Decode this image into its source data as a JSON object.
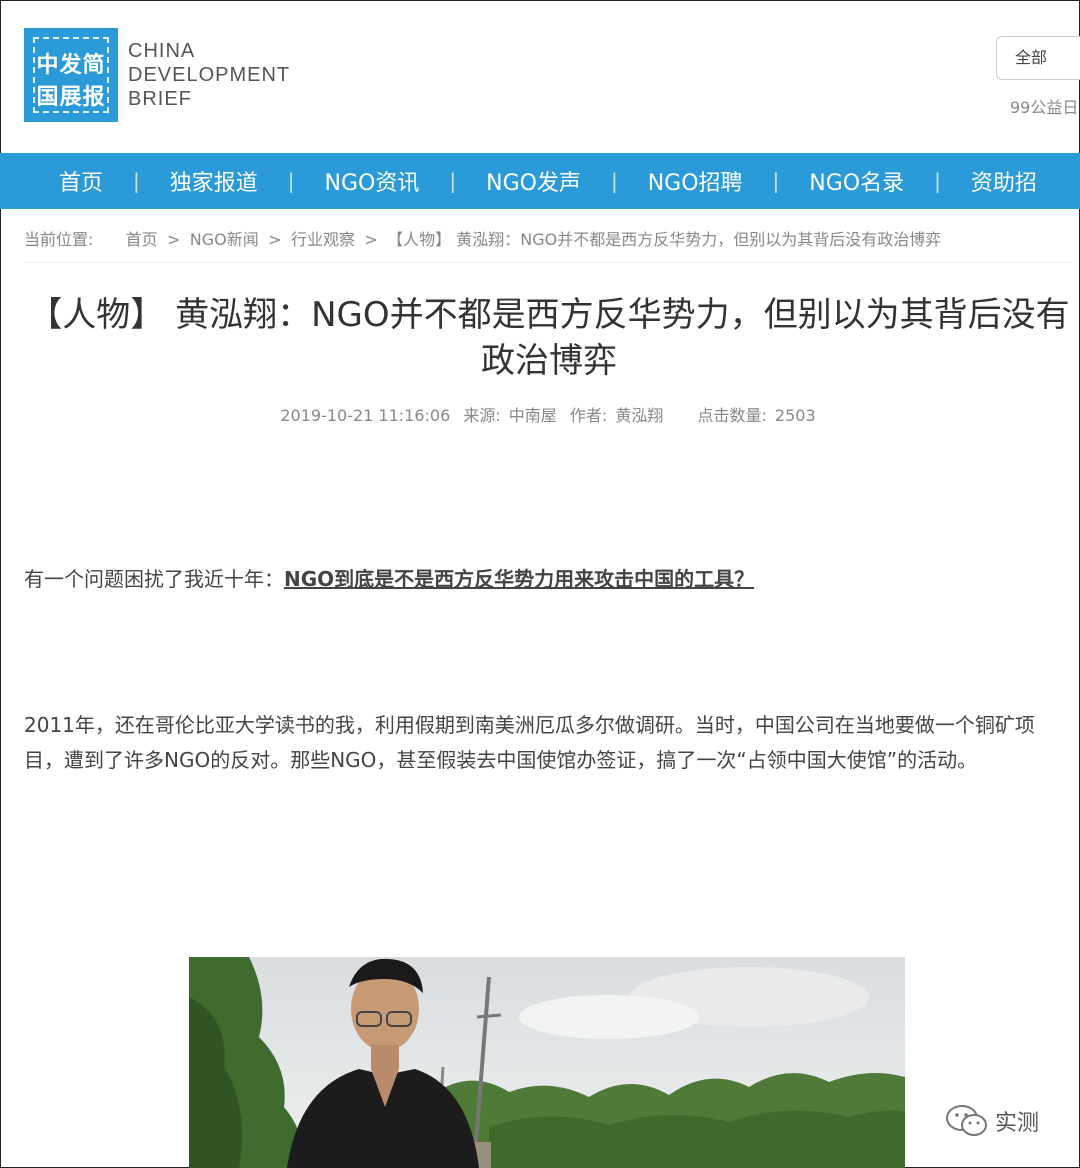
{
  "brand": {
    "logo_cn_line1": "中发简",
    "logo_cn_line2": "国展报",
    "logo_en_line1": "CHINA",
    "logo_en_line2": "DEVELOPMENT",
    "logo_en_line3": "BRIEF",
    "color": "#2a9ad8"
  },
  "header": {
    "search_scope": "全部",
    "sub_link": "99公益日"
  },
  "nav": {
    "items": [
      "首页",
      "独家报道",
      "NGO资讯",
      "NGO发声",
      "NGO招聘",
      "NGO名录",
      "资助招"
    ]
  },
  "breadcrumb": {
    "prefix": "当前位置:",
    "items": [
      "首页",
      "NGO新闻",
      "行业观察",
      "【人物】 黄泓翔：NGO并不都是西方反华势力，但别以为其背后没有政治博弈"
    ],
    "separator": ">"
  },
  "article": {
    "title": "【人物】 黄泓翔：NGO并不都是西方反华势力，但别以为其背后没有政治博弈",
    "datetime": "2019-10-21 11:16:06",
    "source_label": "来源:",
    "source": "中南屋",
    "author_label": "作者:",
    "author": "黄泓翔",
    "views_label": "点击数量:",
    "views": "2503",
    "p1_text": "有一个问题困扰了我近十年：",
    "p1_link": "NGO到底是不是西方反华势力用来攻击中国的工具？",
    "p2_text": "2011年，还在哥伦比亚大学读书的我，利用假期到南美洲厄瓜多尔做调研。当时，中国公司在当地要做一个铜矿项目，遭到了许多NGO的反对。那些NGO，甚至假装去中国使馆办签证，搞了一次“占领中国大使馆”的活动。"
  },
  "watermark": {
    "label": "实测"
  }
}
